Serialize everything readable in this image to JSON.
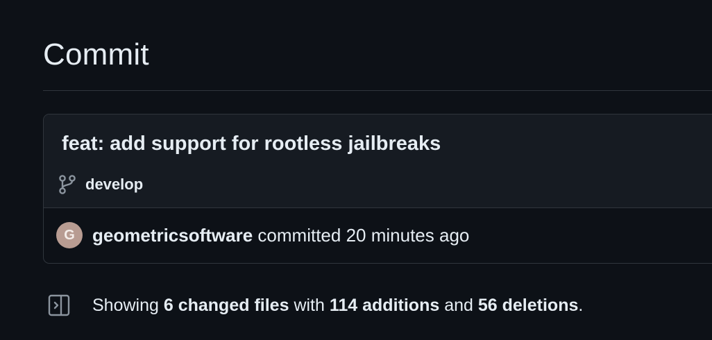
{
  "page": {
    "title": "Commit"
  },
  "commit": {
    "message": "feat: add support for rootless jailbreaks",
    "branch": "develop",
    "author": "geometricsoftware",
    "action": "committed",
    "time": "20 minutes ago",
    "avatar_initial": "G",
    "avatar_color": "#b89c92"
  },
  "summary": {
    "prefix": "Showing",
    "files": "6 changed files",
    "with": "with",
    "additions": "114 additions",
    "and": "and",
    "deletions": "56 deletions",
    "suffix": "."
  },
  "icons": {
    "branch": "git-branch-icon",
    "sidebar": "sidebar-toggle-icon"
  },
  "colors": {
    "background": "#0d1117",
    "panel": "#161b22",
    "border": "#30363d",
    "text": "#e6edf3",
    "muted_icon": "#8b949e"
  }
}
